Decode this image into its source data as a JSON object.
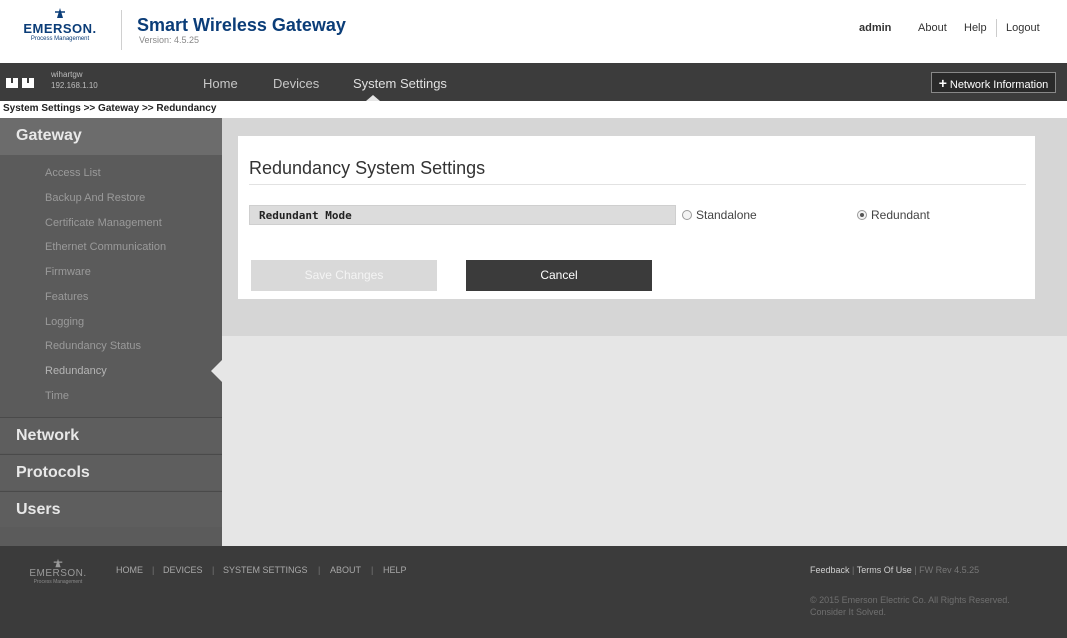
{
  "header": {
    "brand": "EMERSON.",
    "brand_sub": "Process Management",
    "title": "Smart Wireless Gateway",
    "version": "Version: 4.5.25",
    "user": "admin",
    "links": [
      "About",
      "Help",
      "Logout"
    ]
  },
  "nav": {
    "device_name": "wihartgw",
    "device_ip": "192.168.1.10",
    "items": [
      "Home",
      "Devices",
      "System Settings"
    ],
    "active": "System Settings",
    "network_info_label": "Network Information"
  },
  "breadcrumb": "System Settings >> Gateway >> Redundancy",
  "sidebar": {
    "gateway_title": "Gateway",
    "gateway_items": [
      "Access List",
      "Backup And Restore",
      "Certificate Management",
      "Ethernet Communication",
      "Firmware",
      "Features",
      "Logging",
      "Redundancy Status",
      "Redundancy",
      "Time"
    ],
    "active_item": "Redundancy",
    "sections": [
      "Network",
      "Protocols",
      "Users"
    ]
  },
  "main": {
    "title": "Redundancy System Settings",
    "field_label": "Redundant Mode",
    "options": [
      "Standalone",
      "Redundant"
    ],
    "selected_option": "Redundant",
    "save_label": "Save Changes",
    "cancel_label": "Cancel"
  },
  "footer": {
    "brand": "EMERSON.",
    "brand_sub": "Process Management",
    "links": [
      "HOME",
      "DEVICES",
      "SYSTEM SETTINGS",
      "ABOUT",
      "HELP"
    ],
    "feedback": "Feedback",
    "terms": "Terms Of Use",
    "fw_rev": "FW Rev 4.5.25",
    "copyright": "© 2015 Emerson Electric Co. All Rights Reserved.",
    "tagline": "Consider It Solved."
  },
  "colors": {
    "brand_blue": "#0b3d78",
    "nav_bg": "#3c3c3c",
    "sidebar_bg": "#5b5b5b",
    "footer_bg": "#3b3b3b"
  }
}
